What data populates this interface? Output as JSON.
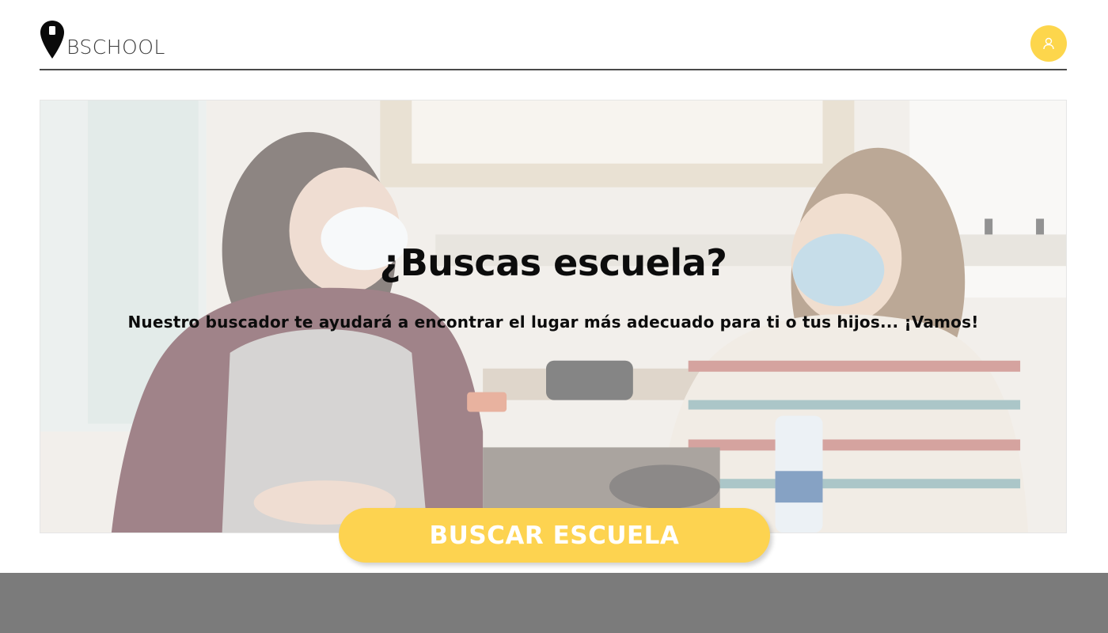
{
  "header": {
    "logo_text": "BSCHOOL",
    "user_icon": "user-icon"
  },
  "hero": {
    "title": "¿Buscas escuela?",
    "subtitle": "Nuestro buscador te ayudará a encontrar el lugar más adecuado para ti o tus hijos... ¡Vamos!"
  },
  "cta": {
    "label": "BUSCAR ESCUELA"
  },
  "colors": {
    "accent": "#fdd350",
    "footer": "#7b7b7b",
    "text": "#0c0c0c"
  }
}
